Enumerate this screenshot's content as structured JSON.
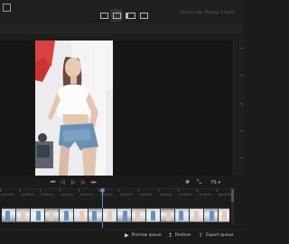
{
  "topbar": {
    "status_text": "Source: clip · Playing: 1 frame",
    "modes": [
      {
        "icon": "crop-icon",
        "active": false
      },
      {
        "icon": "single-view-icon",
        "active": true
      },
      {
        "icon": "split-view-icon",
        "active": false
      },
      {
        "icon": "compare-view-icon",
        "active": false
      }
    ]
  },
  "playback": {
    "buttons": [
      "go-start-icon",
      "previous-frame-icon",
      "play-icon",
      "next-frame-icon",
      "go-end-icon"
    ],
    "glyphs": [
      "⏮",
      "◁",
      "▷",
      "▷",
      "⏭"
    ]
  },
  "tools": {
    "glyphs": [
      "✥",
      "⤡"
    ],
    "zoom_label": "Fit ▾"
  },
  "timeline": {
    "labels": [
      "00:00:00",
      "00:00:05",
      "00:00:10",
      "00:00:15",
      "00:00:20",
      "00:00:25",
      "00:00:30",
      "00:00:35",
      "00:00:40",
      "00:00:45",
      "00:00:50",
      "00:00:55"
    ],
    "playhead_fraction": 0.43
  },
  "bottombar": {
    "preview_label": "Preview queue",
    "restore_label": "Restore",
    "export_label": "Export queue"
  },
  "colors": {
    "accent": "#5a8fd8",
    "background": "#1b1b1b"
  }
}
